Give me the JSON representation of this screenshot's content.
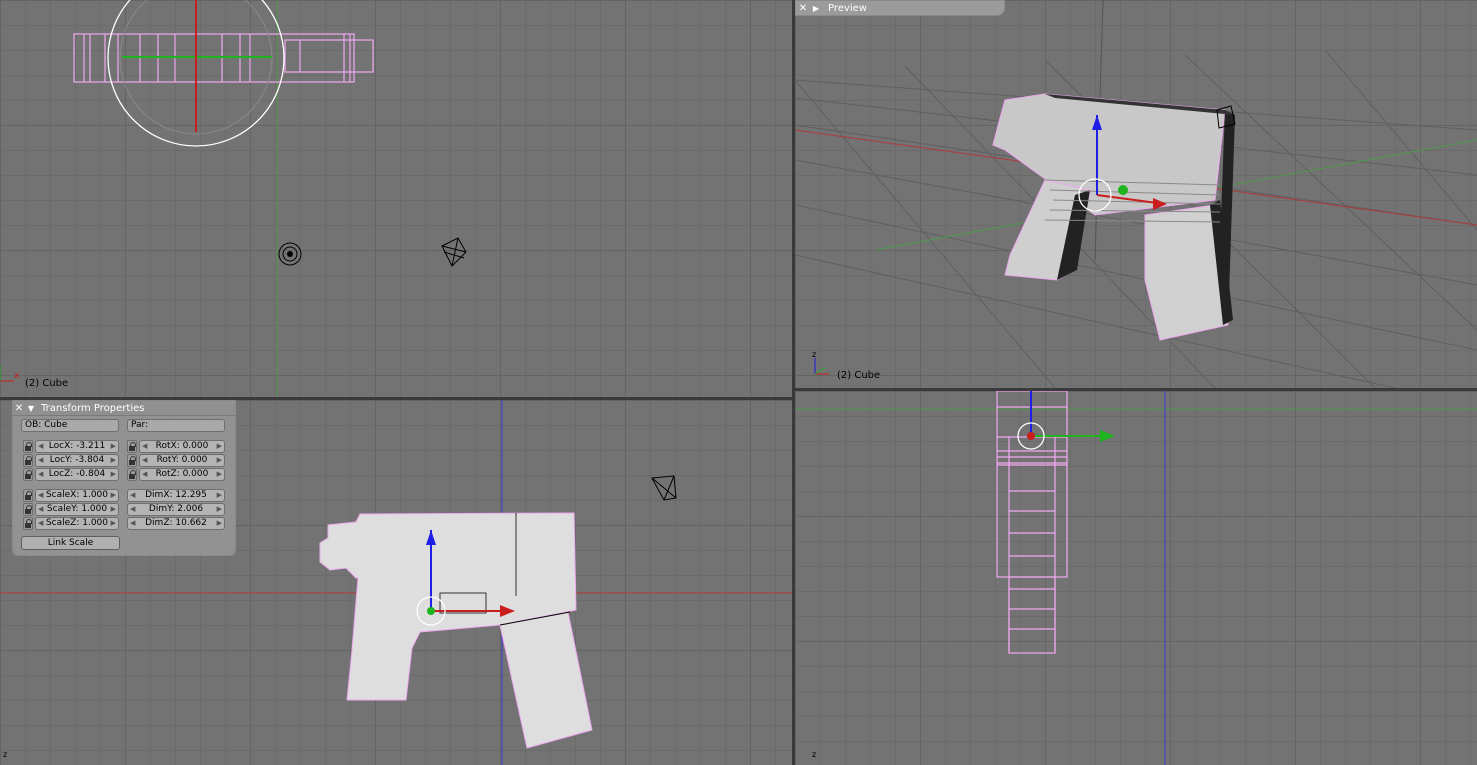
{
  "viewports": {
    "top_left": {
      "label": "(2) Cube",
      "axis_x": "x"
    },
    "top_right": {
      "header_title": "Preview",
      "label": "(2) Cube",
      "axis_z": "z"
    },
    "bottom_left": {
      "axis_z": "z"
    },
    "bottom_right": {
      "axis_z": "z"
    }
  },
  "transform_panel": {
    "title": "Transform Properties",
    "ob": "OB: Cube",
    "par": "Par:",
    "loc": [
      "LocX: -3.211",
      "LocY: -3.804",
      "LocZ: -0.804"
    ],
    "rot": [
      "RotX: 0.000",
      "RotY: 0.000",
      "RotZ: 0.000"
    ],
    "scale": [
      "ScaleX: 1.000",
      "ScaleY: 1.000",
      "ScaleZ: 1.000"
    ],
    "dim": [
      "DimX: 12.295",
      "DimY: 2.006",
      "DimZ: 10.662"
    ],
    "link_scale": "Link Scale"
  },
  "colors": {
    "grid_bg": "#737373",
    "wire": "#f0a8f0",
    "mesh_fill": "#dcdcdc",
    "axis_red": "#c81e1e",
    "axis_green": "#1eb41e",
    "axis_blue": "#1e1ee6"
  }
}
